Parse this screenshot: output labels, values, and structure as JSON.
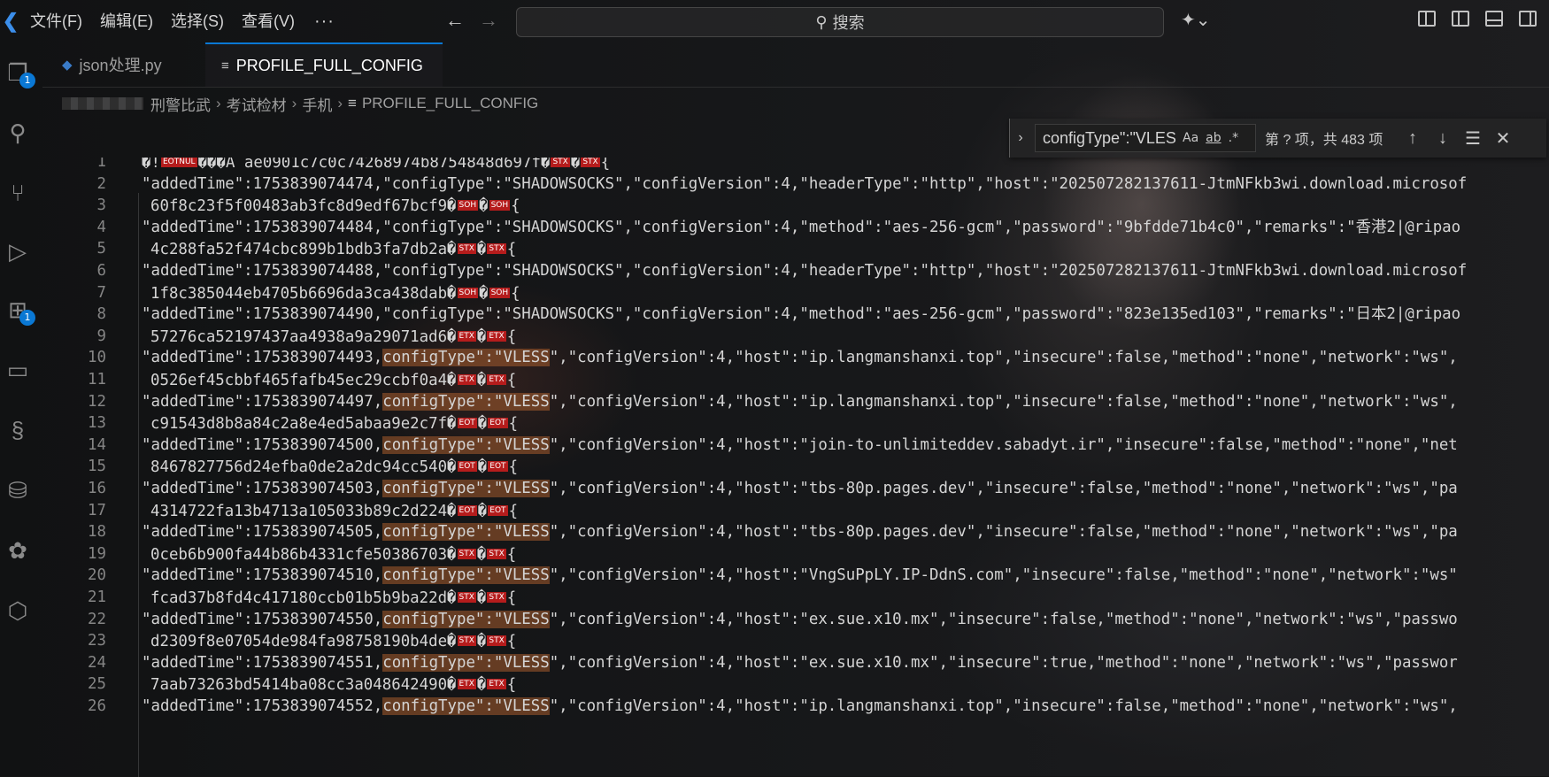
{
  "titlebar": {
    "menus": [
      "文件(F)",
      "编辑(E)",
      "选择(S)",
      "查看(V)"
    ],
    "more": "···",
    "back_icon": "←",
    "forward_icon": "→",
    "search_placeholder": "搜索"
  },
  "activity_badges": {
    "explorer": "1",
    "extensions": "1"
  },
  "tabs": [
    {
      "label": "json处理.py",
      "icon": "python-file-icon"
    },
    {
      "label": "PROFILE_FULL_CONFIG",
      "icon": "text-file-icon",
      "dirty": true
    }
  ],
  "breadcrumb": [
    "刑警比武",
    "考试检材",
    "手机",
    "PROFILE_FULL_CONFIG"
  ],
  "find": {
    "query": "configType\":\"VLES",
    "match_case": "Aa",
    "whole_word": "ab",
    "regex": ".*",
    "count": "第 ? 项，共 483 项"
  },
  "editor": {
    "lines": [
      {
        "n": "1",
        "parts": [
          {
            "t": "�!"
          },
          {
            "c": "EOTNUL"
          },
          {
            "t": "���A ae0901c7c0c74268974b8754848d697f�"
          },
          {
            "c": "STX"
          },
          {
            "t": "�"
          },
          {
            "c": "STX"
          },
          {
            "t": "{"
          }
        ]
      },
      {
        "n": "2",
        "parts": [
          {
            "t": "\"addedTime\":1753839074474,\"configType\":\"SHADOWSOCKS\",\"configVersion\":4,\"headerType\":\"http\",\"host\":\"202507282137611-JtmNFkb3wi.download.microsof"
          }
        ]
      },
      {
        "n": "3",
        "cont": true,
        "parts": [
          {
            "t": "60f8c23f5f00483ab3fc8d9edf67bcf9�"
          },
          {
            "c": "SOH"
          },
          {
            "t": "�"
          },
          {
            "c": "SOH"
          },
          {
            "t": "{"
          }
        ]
      },
      {
        "n": "4",
        "parts": [
          {
            "t": "\"addedTime\":1753839074484,\"configType\":\"SHADOWSOCKS\",\"configVersion\":4,\"method\":\"aes-256-gcm\",\"password\":\"9bfdde71b4c0\",\"remarks\":\"香港2|@ripao"
          }
        ]
      },
      {
        "n": "5",
        "cont": true,
        "parts": [
          {
            "t": "4c288fa52f474cbc899b1bdb3fa7db2a�"
          },
          {
            "c": "STX"
          },
          {
            "t": "�"
          },
          {
            "c": "STX"
          },
          {
            "t": "{"
          }
        ]
      },
      {
        "n": "6",
        "parts": [
          {
            "t": "\"addedTime\":1753839074488,\"configType\":\"SHADOWSOCKS\",\"configVersion\":4,\"headerType\":\"http\",\"host\":\"202507282137611-JtmNFkb3wi.download.microsof"
          }
        ]
      },
      {
        "n": "7",
        "cont": true,
        "parts": [
          {
            "t": "1f8c385044eb4705b6696da3ca438dab�"
          },
          {
            "c": "SOH"
          },
          {
            "t": "�"
          },
          {
            "c": "SOH"
          },
          {
            "t": "{"
          }
        ]
      },
      {
        "n": "8",
        "parts": [
          {
            "t": "\"addedTime\":1753839074490,\"configType\":\"SHADOWSOCKS\",\"configVersion\":4,\"method\":\"aes-256-gcm\",\"password\":\"823e135ed103\",\"remarks\":\"日本2|@ripao"
          }
        ]
      },
      {
        "n": "9",
        "cont": true,
        "parts": [
          {
            "t": "57276ca52197437aa4938a9a29071ad6�"
          },
          {
            "c": "ETX"
          },
          {
            "t": "�"
          },
          {
            "c": "ETX"
          },
          {
            "t": "{"
          }
        ]
      },
      {
        "n": "10",
        "parts": [
          {
            "t": "\"addedTime\":1753839074493,"
          },
          {
            "h": "configType\":\"VLESS"
          },
          {
            "t": "\",\"configVersion\":4,\"host\":\"ip.langmanshanxi.top\",\"insecure\":false,\"method\":\"none\",\"network\":\"ws\","
          }
        ]
      },
      {
        "n": "11",
        "cont": true,
        "parts": [
          {
            "t": "0526ef45cbbf465fafb45ec29ccbf0a4�"
          },
          {
            "c": "ETX"
          },
          {
            "t": "�"
          },
          {
            "c": "ETX"
          },
          {
            "t": "{"
          }
        ]
      },
      {
        "n": "12",
        "parts": [
          {
            "t": "\"addedTime\":1753839074497,"
          },
          {
            "h": "configType\":\"VLESS"
          },
          {
            "t": "\",\"configVersion\":4,\"host\":\"ip.langmanshanxi.top\",\"insecure\":false,\"method\":\"none\",\"network\":\"ws\","
          }
        ]
      },
      {
        "n": "13",
        "cont": true,
        "parts": [
          {
            "t": "c91543d8b8a84c2a8e4ed5abaa9e2c7f�"
          },
          {
            "c": "EOT"
          },
          {
            "t": "�"
          },
          {
            "c": "EOT"
          },
          {
            "t": "{"
          }
        ]
      },
      {
        "n": "14",
        "parts": [
          {
            "t": "\"addedTime\":1753839074500,"
          },
          {
            "h": "configType\":\"VLESS"
          },
          {
            "t": "\",\"configVersion\":4,\"host\":\"join-to-unlimiteddev.sabadyt.ir\",\"insecure\":false,\"method\":\"none\",\"net"
          }
        ]
      },
      {
        "n": "15",
        "cont": true,
        "parts": [
          {
            "t": "8467827756d24efba0de2a2dc94cc540�"
          },
          {
            "c": "EOT"
          },
          {
            "t": "�"
          },
          {
            "c": "EOT"
          },
          {
            "t": "{"
          }
        ]
      },
      {
        "n": "16",
        "parts": [
          {
            "t": "\"addedTime\":1753839074503,"
          },
          {
            "h": "configType\":\"VLESS"
          },
          {
            "t": "\",\"configVersion\":4,\"host\":\"tbs-80p.pages.dev\",\"insecure\":false,\"method\":\"none\",\"network\":\"ws\",\"pa"
          }
        ]
      },
      {
        "n": "17",
        "cont": true,
        "parts": [
          {
            "t": "4314722fa13b4713a105033b89c2d224�"
          },
          {
            "c": "EOT"
          },
          {
            "t": "�"
          },
          {
            "c": "EOT"
          },
          {
            "t": "{"
          }
        ]
      },
      {
        "n": "18",
        "parts": [
          {
            "t": "\"addedTime\":1753839074505,"
          },
          {
            "h": "configType\":\"VLESS"
          },
          {
            "t": "\",\"configVersion\":4,\"host\":\"tbs-80p.pages.dev\",\"insecure\":false,\"method\":\"none\",\"network\":\"ws\",\"pa"
          }
        ]
      },
      {
        "n": "19",
        "cont": true,
        "parts": [
          {
            "t": "0ceb6b900fa44b86b4331cfe50386703�"
          },
          {
            "c": "STX"
          },
          {
            "t": "�"
          },
          {
            "c": "STX"
          },
          {
            "t": "{"
          }
        ]
      },
      {
        "n": "20",
        "parts": [
          {
            "t": "\"addedTime\":1753839074510,"
          },
          {
            "h": "configType\":\"VLESS"
          },
          {
            "t": "\",\"configVersion\":4,\"host\":\"VngSuPpLY.IP-DdnS.com\",\"insecure\":false,\"method\":\"none\",\"network\":\"ws\""
          }
        ]
      },
      {
        "n": "21",
        "cont": true,
        "parts": [
          {
            "t": "fcad37b8fd4c417180ccb01b5b9ba22d�"
          },
          {
            "c": "STX"
          },
          {
            "t": "�"
          },
          {
            "c": "STX"
          },
          {
            "t": "{"
          }
        ]
      },
      {
        "n": "22",
        "parts": [
          {
            "t": "\"addedTime\":1753839074550,"
          },
          {
            "h": "configType\":\"VLESS"
          },
          {
            "t": "\",\"configVersion\":4,\"host\":\"ex.sue.x10.mx\",\"insecure\":false,\"method\":\"none\",\"network\":\"ws\",\"passwo"
          }
        ]
      },
      {
        "n": "23",
        "cont": true,
        "parts": [
          {
            "t": "d2309f8e07054de984fa98758190b4de�"
          },
          {
            "c": "STX"
          },
          {
            "t": "�"
          },
          {
            "c": "STX"
          },
          {
            "t": "{"
          }
        ]
      },
      {
        "n": "24",
        "parts": [
          {
            "t": "\"addedTime\":1753839074551,"
          },
          {
            "h": "configType\":\"VLESS"
          },
          {
            "t": "\",\"configVersion\":4,\"host\":\"ex.sue.x10.mx\",\"insecure\":true,\"method\":\"none\",\"network\":\"ws\",\"passwor"
          }
        ]
      },
      {
        "n": "25",
        "cont": true,
        "parts": [
          {
            "t": "7aab73263bd5414ba08cc3a048642490�"
          },
          {
            "c": "ETX"
          },
          {
            "t": "�"
          },
          {
            "c": "ETX"
          },
          {
            "t": "{"
          }
        ]
      },
      {
        "n": "26",
        "parts": [
          {
            "t": "\"addedTime\":1753839074552,"
          },
          {
            "h": "configType\":\"VLESS"
          },
          {
            "t": "\",\"configVersion\":4,\"host\":\"ip.langmanshanxi.top\",\"insecure\":false,\"method\":\"none\",\"network\":\"ws\","
          }
        ]
      }
    ]
  }
}
